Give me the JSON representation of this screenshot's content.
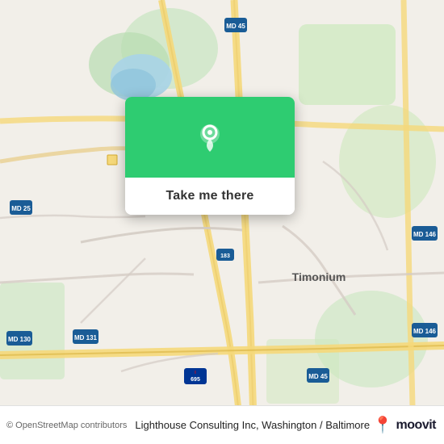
{
  "map": {
    "background_color": "#f2efe9",
    "center": "Timonium, MD area"
  },
  "popup": {
    "button_label": "Take me there",
    "pin_color": "#ffffff",
    "background_color": "#2ecc71"
  },
  "bottom_bar": {
    "copyright_text": "© OpenStreetMap contributors",
    "location_title": "Lighthouse Consulting Inc, Washington / Baltimore",
    "moovit_text": "moovit"
  }
}
